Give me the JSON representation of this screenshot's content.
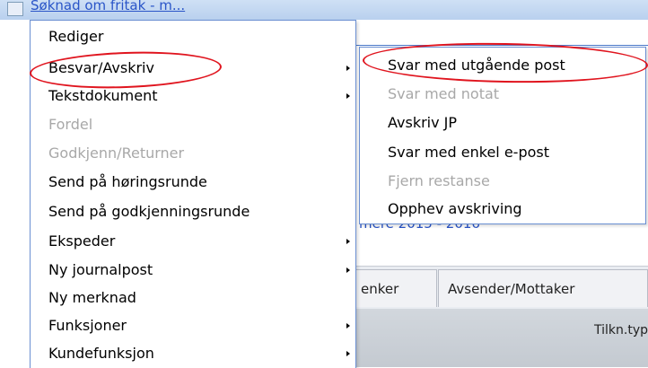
{
  "window": {
    "title": "Søknad om fritak - m..."
  },
  "main_menu": {
    "items": [
      {
        "label": "Rediger",
        "enabled": true,
        "submenu": false
      },
      {
        "label": "Besvar/Avskriv",
        "enabled": true,
        "submenu": true
      },
      {
        "label": "Tekstdokument",
        "enabled": true,
        "submenu": true
      },
      {
        "label": "Fordel",
        "enabled": false,
        "submenu": false
      },
      {
        "label": "Godkjenn/Returner",
        "enabled": false,
        "submenu": false
      },
      {
        "label": "Send på høringsrunde",
        "enabled": true,
        "submenu": false
      },
      {
        "label": "Send på godkjenningsrunde",
        "enabled": true,
        "submenu": false
      },
      {
        "label": "Ekspeder",
        "enabled": true,
        "submenu": true
      },
      {
        "label": "Ny journalpost",
        "enabled": true,
        "submenu": true
      },
      {
        "label": "Ny merknad",
        "enabled": true,
        "submenu": false
      },
      {
        "label": "Funksjoner",
        "enabled": true,
        "submenu": true
      },
      {
        "label": "Kundefunksjon",
        "enabled": true,
        "submenu": true
      }
    ]
  },
  "submenu": {
    "items": [
      {
        "label": "Svar med utgående post",
        "enabled": true
      },
      {
        "label": "Svar med notat",
        "enabled": false
      },
      {
        "label": "Avskriv JP",
        "enabled": true
      },
      {
        "label": "Svar med enkel e-post",
        "enabled": true
      },
      {
        "label": "Fjern restanse",
        "enabled": false
      },
      {
        "label": "Opphev avskriving",
        "enabled": true
      }
    ]
  },
  "background": {
    "link_text": "mere 2015 - 2016",
    "tabs": [
      "enker",
      "Avsender/Mottaker"
    ],
    "grid_header_label": "Tilkn.typ"
  },
  "colors": {
    "highlight_annotation": "#e0141e",
    "disabled_text": "#a8a8a8",
    "menu_border": "#6a8fd2",
    "link": "#2a55c8"
  }
}
